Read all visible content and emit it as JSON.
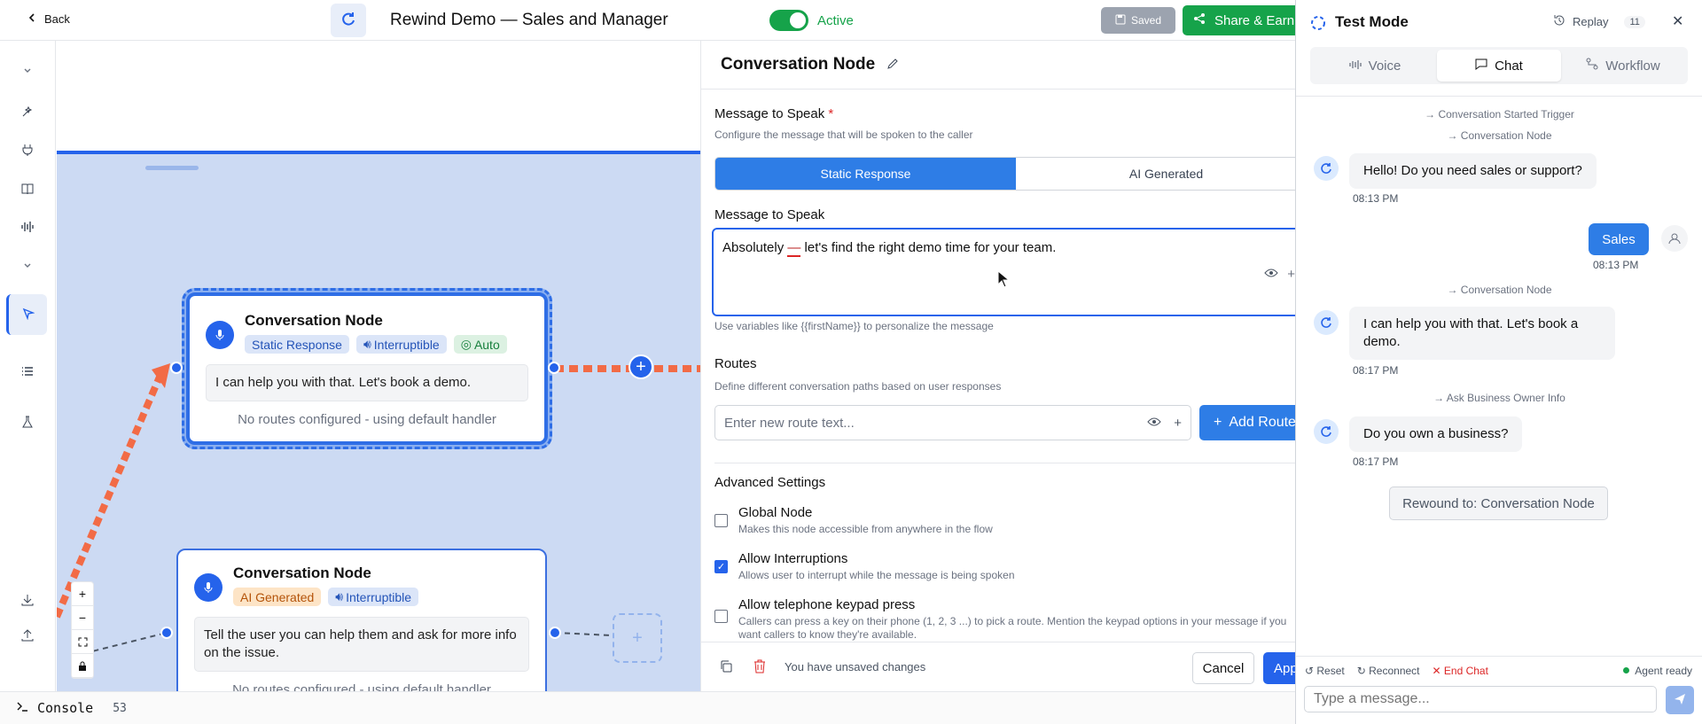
{
  "topbar": {
    "back_label": "Back",
    "title": "Rewind Demo — Sales and Manager",
    "status_label": "Active",
    "saved_label": "Saved",
    "share_label": "Share & Earn",
    "accent_color": "#16a34a"
  },
  "canvas": {
    "nodes": [
      {
        "title": "Conversation Node",
        "tags": [
          "Static Response",
          "Interruptible",
          "Auto"
        ],
        "message": "I can help you with that. Let's book a demo.",
        "footer": "No routes configured - using default handler"
      },
      {
        "title": "Conversation Node",
        "tags": [
          "AI Generated",
          "Interruptible"
        ],
        "message": "Tell the user you can help them and ask for more info on the issue.",
        "footer": "No routes configured - using default handler"
      }
    ]
  },
  "editor": {
    "title": "Conversation Node",
    "message_section_label": "Message to Speak",
    "required_mark": "*",
    "message_section_desc": "Configure the message that will be spoken to the caller",
    "mode_static": "Static Response",
    "mode_ai": "AI Generated",
    "message_label": "Message to Speak",
    "message_before": "Absolutely ",
    "message_dash": "—",
    "message_after": " let's find the right demo time for your team.",
    "variables_hint": "Use variables like {{firstName}} to personalize the message",
    "routes_label": "Routes",
    "routes_desc": "Define different conversation paths based on user responses",
    "route_placeholder": "Enter new route text...",
    "add_route_label": "Add Route",
    "advanced_label": "Advanced Settings",
    "settings": [
      {
        "title": "Global Node",
        "desc": "Makes this node accessible from anywhere in the flow",
        "checked": false
      },
      {
        "title": "Allow Interruptions",
        "desc": "Allows user to interrupt while the message is being spoken",
        "checked": true
      },
      {
        "title": "Allow telephone keypad press",
        "desc": "Callers can press a key on their phone (1, 2, 3 ...) to pick a route. Mention the keypad options in your message if you want callers to know they're available.",
        "checked": false
      }
    ],
    "unsaved_label": "You have unsaved changes",
    "cancel_label": "Cancel",
    "apply_label": "Apply"
  },
  "test": {
    "title": "Test Mode",
    "replay_label": "Replay",
    "replay_count": "11",
    "tabs": [
      "Voice",
      "Chat",
      "Workflow"
    ],
    "active_tab": "Chat",
    "messages": {
      "trigger_started": "→ Conversation Started Trigger",
      "trigger_node1": "→ Conversation Node",
      "bot1": "Hello! Do you need sales or support?",
      "bot1_time": "08:13 PM",
      "user1": "Sales",
      "user1_time": "08:13 PM",
      "trigger_node2": "→ Conversation Node",
      "bot2": "I can help you with that. Let's book a demo.",
      "bot2_time": "08:17 PM",
      "trigger_ask": "→ Ask Business Owner Info",
      "bot3": "Do you own a business?",
      "bot3_time": "08:17 PM",
      "rewound": "Rewound to: Conversation Node"
    },
    "actions": {
      "reset": "Reset",
      "reconnect": "Reconnect",
      "end_chat": "End Chat",
      "agent_status": "Agent ready"
    },
    "input_placeholder": "Type a message..."
  },
  "console": {
    "label": "Console",
    "count": "53"
  }
}
